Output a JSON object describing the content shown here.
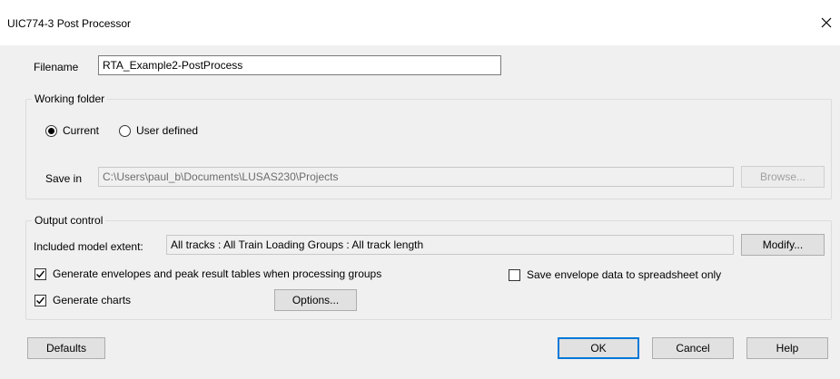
{
  "window": {
    "title": "UIC774-3 Post Processor"
  },
  "filename": {
    "label": "Filename",
    "value": "RTA_Example2-PostProcess"
  },
  "working_folder": {
    "title": "Working folder",
    "option_current": "Current",
    "option_user_defined": "User defined",
    "selected": "Current",
    "save_in_label": "Save in",
    "save_in_value": "C:\\Users\\paul_b\\Documents\\LUSAS230\\Projects",
    "browse_label": "Browse..."
  },
  "output_control": {
    "title": "Output control",
    "extent_label": "Included model extent:",
    "extent_value": "All tracks : All Train Loading Groups : All track length",
    "modify_label": "Modify...",
    "generate_envelopes_label": "Generate envelopes and peak result tables when processing groups",
    "generate_envelopes_checked": true,
    "save_envelope_label": "Save envelope data to spreadsheet only",
    "save_envelope_checked": false,
    "generate_charts_label": "Generate charts",
    "generate_charts_checked": true,
    "options_label": "Options..."
  },
  "footer": {
    "defaults_label": "Defaults",
    "ok_label": "OK",
    "cancel_label": "Cancel",
    "help_label": "Help"
  }
}
